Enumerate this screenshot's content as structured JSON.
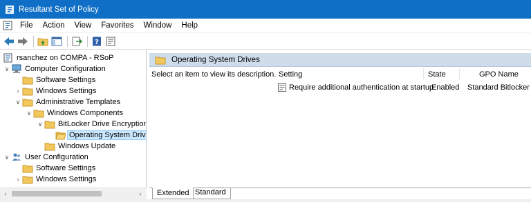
{
  "window": {
    "title": "Resultant Set of Policy"
  },
  "menu": {
    "items": [
      "File",
      "Action",
      "View",
      "Favorites",
      "Window",
      "Help"
    ]
  },
  "toolbar": {
    "buttons": [
      "back-arrow-icon",
      "forward-arrow-icon",
      "up-folder-icon",
      "show-hide-tree-icon",
      "export-list-icon",
      "help-icon",
      "properties-icon"
    ]
  },
  "tree": {
    "root": "rsanchez on COMPA - RSoP",
    "computer_configuration": "Computer Configuration",
    "cc_software_settings": "Software Settings",
    "cc_windows_settings": "Windows Settings",
    "administrative_templates": "Administrative Templates",
    "windows_components": "Windows Components",
    "bitlocker": "BitLocker Drive Encryption",
    "os_drives": "Operating System Drive",
    "windows_update": "Windows Update",
    "user_configuration": "User Configuration",
    "uc_software_settings": "Software Settings",
    "uc_windows_settings": "Windows Settings"
  },
  "details": {
    "header": "Operating System Drives",
    "description": "Select an item to view its description.",
    "columns": {
      "setting": "Setting",
      "state": "State",
      "gpo": "GPO Name"
    },
    "rows": [
      {
        "setting": "Require additional authentication at startup",
        "state": "Enabled",
        "gpo": "Standard Bitlocker"
      }
    ]
  },
  "tabs": {
    "extended": "Extended",
    "standard": "Standard"
  },
  "colors": {
    "titlebar": "#0f6fc6",
    "header": "#cfdcea",
    "selection": "#cce8ff",
    "folder": "#f2c75c"
  }
}
